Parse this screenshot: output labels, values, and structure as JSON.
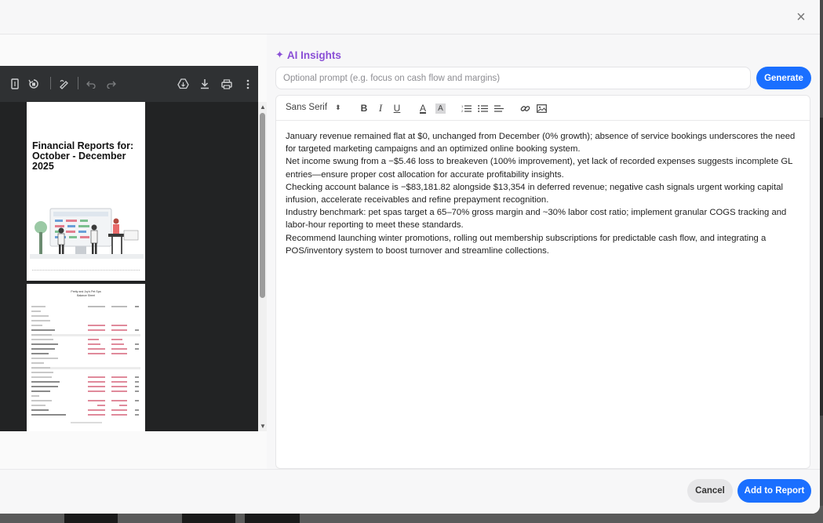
{
  "dialog": {
    "close_icon": "×",
    "close_icon_name": "close-icon"
  },
  "viewer": {
    "toolbar_icons": [
      "page-fit-icon",
      "rotate-icon",
      "annotate-icon",
      "undo-icon",
      "redo-icon",
      "drive-icon",
      "download-icon",
      "print-icon",
      "more-icon"
    ],
    "page1": {
      "title": "Financial Reports for: October - December 2025"
    },
    "page2": {
      "title_line1": "Pretty and Joy's Pet Spa",
      "title_line2": "Balance Sheet"
    }
  },
  "ai_insights": {
    "title": "AI Insights",
    "sparkle_icon": "✦",
    "prompt_placeholder": "Optional prompt (e.g. focus on cash flow and margins)",
    "prompt_value": "",
    "generate_label": "Generate"
  },
  "editor": {
    "font": "Sans Serif",
    "toolbar": {
      "bold": "B",
      "italic": "I",
      "underline": "U",
      "text_color": "A",
      "bg_color": "A"
    },
    "paragraphs": [
      "January revenue remained flat at $0, unchanged from December (0% growth); absence of service bookings underscores the need for targeted marketing campaigns and an optimized online booking system.",
      "Net income swung from a −$5.46 loss to breakeven (100% improvement), yet lack of recorded expenses suggests incomplete GL entries—ensure proper cost allocation for accurate profitability insights.",
      "Checking account balance is −$83,181.82 alongside $13,354 in deferred revenue; negative cash signals urgent working capital infusion, accelerate receivables and refine prepayment recognition.",
      "Industry benchmark: pet spas target a 65–70% gross margin and ~30% labor cost ratio; implement granular COGS tracking and labor-hour reporting to meet these standards.",
      "Recommend launching winter promotions, rolling out membership subscriptions for predictable cash flow, and integrating a POS/inventory system to boost turnover and streamline collections."
    ]
  },
  "footer": {
    "cancel_label": "Cancel",
    "add_label": "Add to Report"
  },
  "colors": {
    "accent_purple": "#8a4fd6",
    "primary_blue": "#1a6fff"
  }
}
